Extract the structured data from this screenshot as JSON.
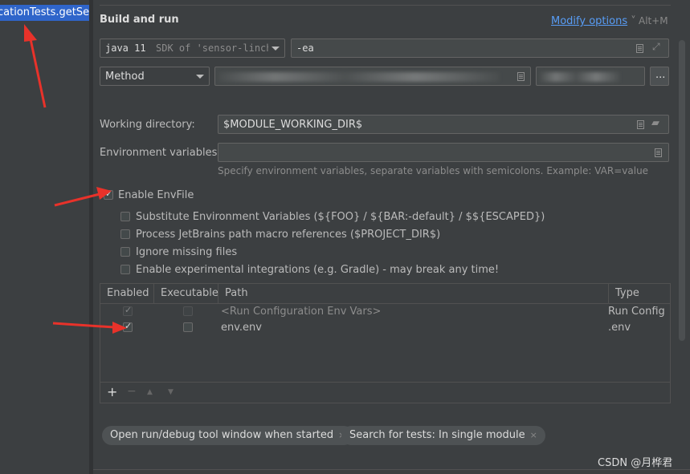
{
  "left": {
    "selected_item": "cationTests.getSens"
  },
  "header": {
    "title": "Build and run",
    "modify_options": "Modify options",
    "modify_caret": "˅",
    "shortcut": "Alt+M"
  },
  "jre": {
    "value_bold": "java 11",
    "value_rest": "SDK of 'sensor-linche"
  },
  "vm_options": {
    "value": "-ea"
  },
  "test_kind": {
    "value": "Method"
  },
  "more_button": "...",
  "working_dir": {
    "label": "Working directory:",
    "value": "$MODULE_WORKING_DIR$"
  },
  "env_vars": {
    "label": "Environment variables:",
    "value": "",
    "hint": "Specify environment variables, separate variables with semicolons. Example: VAR=value"
  },
  "envfile": {
    "enable_label": "Enable EnvFile",
    "options": [
      "Substitute Environment Variables (${FOO} / ${BAR:-default} / $${ESCAPED})",
      "Process JetBrains path macro references ($PROJECT_DIR$)",
      "Ignore missing files",
      "Enable experimental integrations (e.g. Gradle) - may break any time!"
    ]
  },
  "table": {
    "headers": [
      "Enabled",
      "Executable",
      "Path",
      "Type"
    ],
    "rows": [
      {
        "path": "<Run Configuration Env Vars>",
        "type": "Run Config"
      },
      {
        "path": "env.env",
        "type": ".env"
      }
    ],
    "toolbar": {
      "add": "+",
      "remove": "−",
      "up": "▲",
      "down": "▼"
    }
  },
  "tags": [
    {
      "label": "Open run/debug tool window when started",
      "close": "×"
    },
    {
      "label": "Search for tests: In single module",
      "close": "×"
    }
  ],
  "watermark": "CSDN @月桦君",
  "colors": {
    "accent": "#589df6",
    "selection": "#2f65ca",
    "annotation": "#e8322a"
  }
}
